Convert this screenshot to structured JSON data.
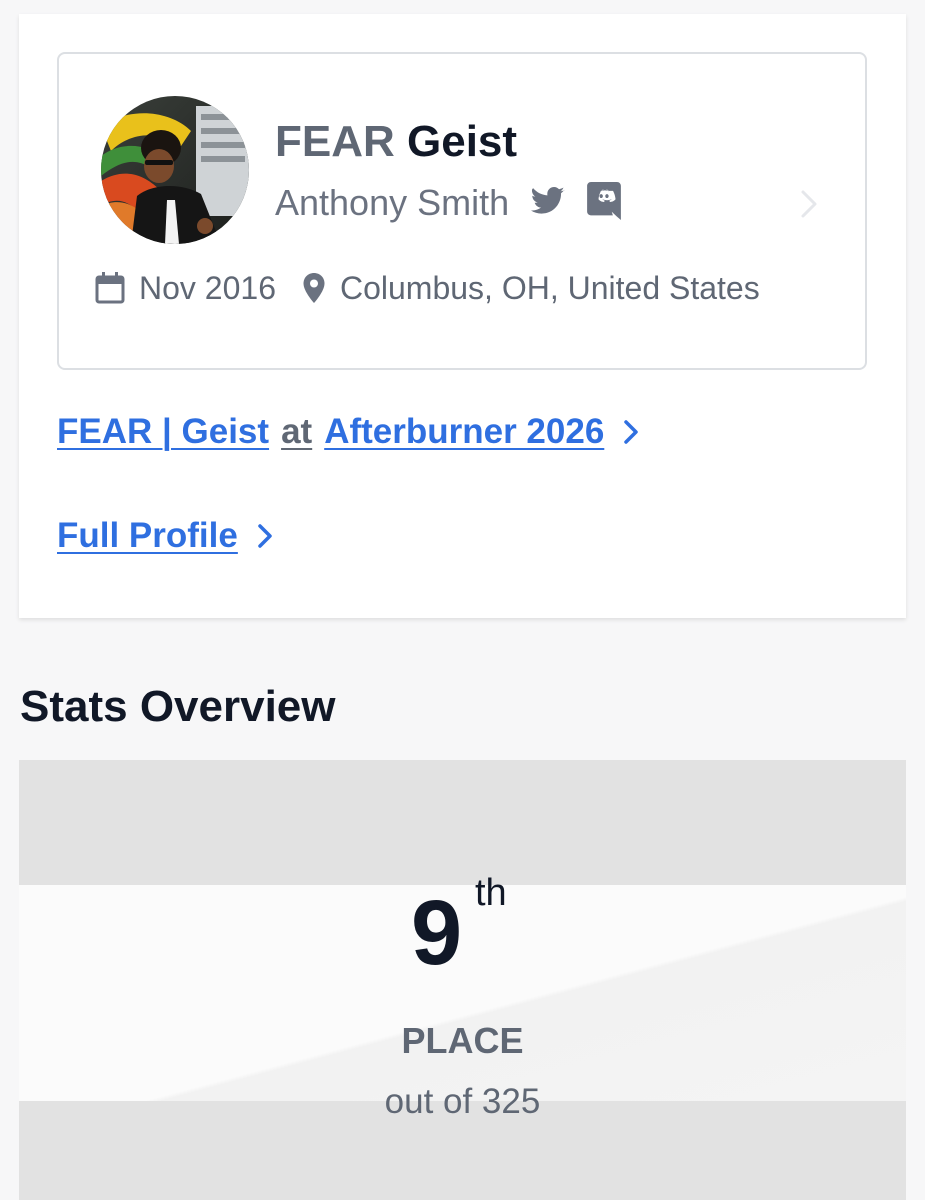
{
  "profile": {
    "gamer_prefix": "FEAR",
    "gamer_name": "Geist",
    "real_name": "Anthony Smith",
    "joined": "Nov 2016",
    "location": "Columbus, OH, United States",
    "avatar_icon": "player-avatar-photo",
    "social_icons": [
      "twitter-icon",
      "discord-icon"
    ]
  },
  "links": {
    "event": {
      "player": "FEAR | Geist",
      "connector": "at",
      "tournament": "Afterburner 2026"
    },
    "full_profile": "Full Profile"
  },
  "stats": {
    "section_title": "Stats Overview",
    "place_number": "9",
    "place_suffix": "th",
    "place_label": "PLACE",
    "place_total": "out of 325"
  },
  "colors": {
    "link": "#2f6fe0",
    "muted_text": "#5f6774",
    "dark_text": "#111827",
    "card_border": "#dcdfe3",
    "stats_bg": "#e2e2e2"
  }
}
